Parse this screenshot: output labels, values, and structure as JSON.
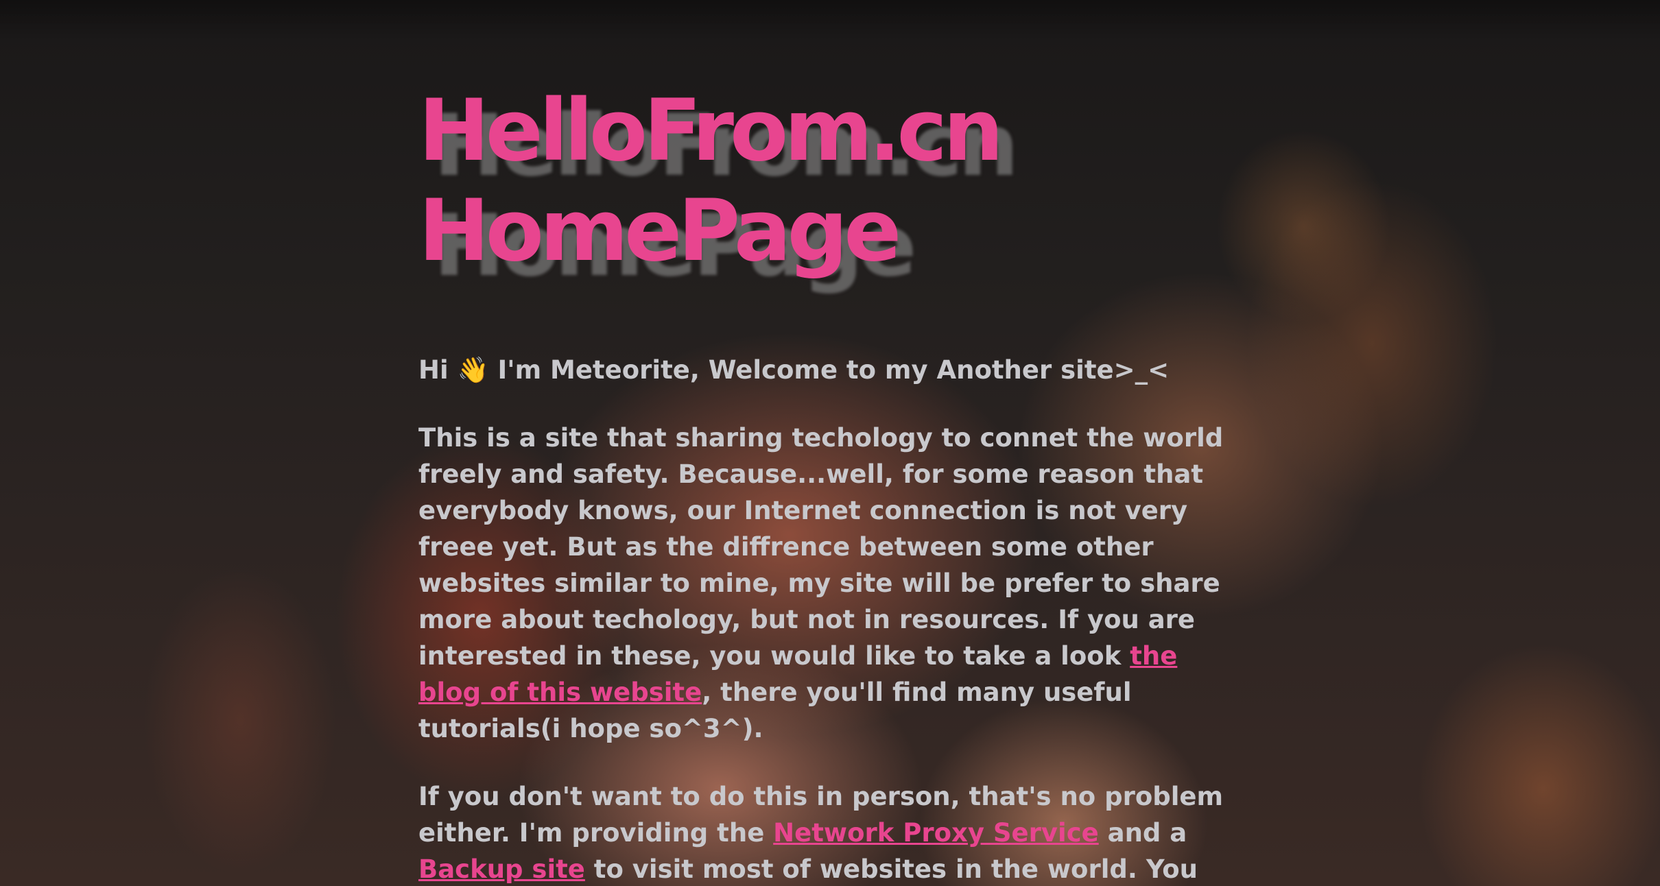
{
  "header": {
    "title_line1": "HelloFrom.cn",
    "title_line2": "HomePage"
  },
  "greeting": {
    "before": "Hi ",
    "emoji": "👋",
    "after": " I'm Meteorite, Welcome to my Another site>_<"
  },
  "intro": {
    "text_before_link": "This is a site that sharing techology to connet the world freely and safety. Because...well, for some reason that everybody knows, our Internet connection is not very freee yet. But as the diffrence between some other websites similar to mine, my site will be prefer to share more about techology, but not in resources. If you are interested in these, you would like to take a look ",
    "blog_link": "the blog of this website",
    "text_after_link": ", there you'll find many useful tutorials(i hope so^3^)."
  },
  "services": {
    "text_start": "If you don't want to do this in person, that's no problem either. I'm providing the ",
    "proxy_link": "Network Proxy Service",
    "text_middle": " and a ",
    "backup_link": "Backup site",
    "text_end": " to visit most of websites in the world. You can choose which you like."
  },
  "colors": {
    "accent": "#e8458f",
    "text": "#c8c8cc",
    "background": "#1b1919"
  }
}
